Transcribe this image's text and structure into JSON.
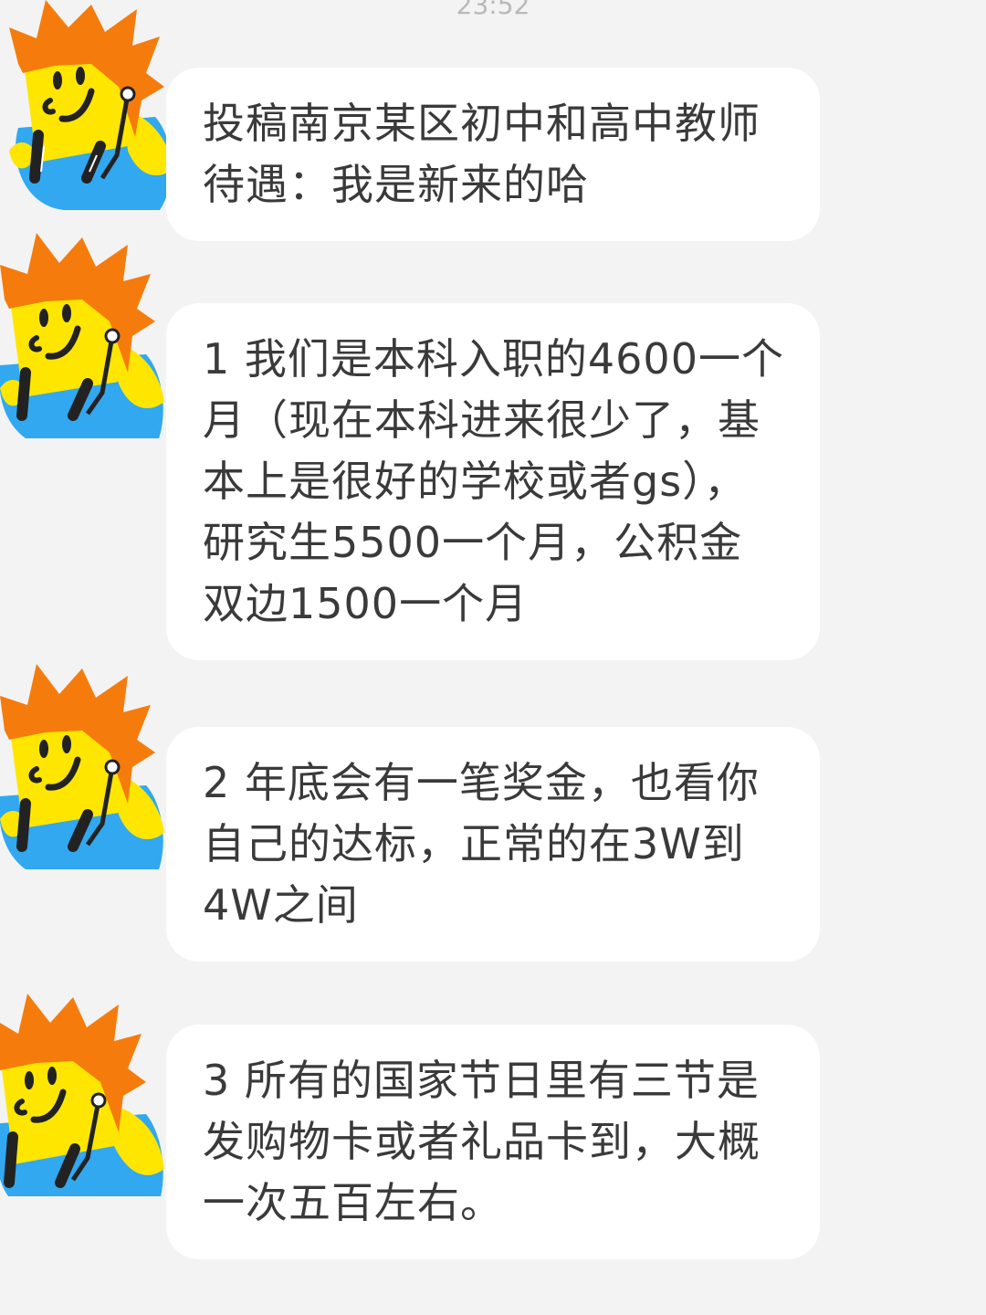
{
  "status": {
    "time": "23:52"
  },
  "chat": {
    "messages": [
      {
        "sender": "avatar-boy",
        "text": "投稿南京某区初中和高中教师\n待遇：我是新来的哈"
      },
      {
        "sender": "avatar-boy",
        "text": "1 我们是本科入职的4600一个\n月（现在本科进来很少了，基\n本上是很好的学校或者gs），\n研究生5500一个月，公积金\n双边1500一个月"
      },
      {
        "sender": "avatar-boy",
        "text": "2 年底会有一笔奖金，也看你\n自己的达标，正常的在3W到\n4W之间"
      },
      {
        "sender": "avatar-boy",
        "text": "3 所有的国家节日里有三节是\n发购物卡或者礼品卡到，大概\n一次五百左右。"
      }
    ]
  },
  "colors": {
    "background": "#f3f3f3",
    "bubble": "#ffffff",
    "text": "#3a3a3a",
    "hair": "#f57c0c",
    "face": "#ffe600",
    "shirt": "#31a8f0"
  },
  "icons": {
    "avatar": "cartoon-boy-avatar-icon"
  }
}
